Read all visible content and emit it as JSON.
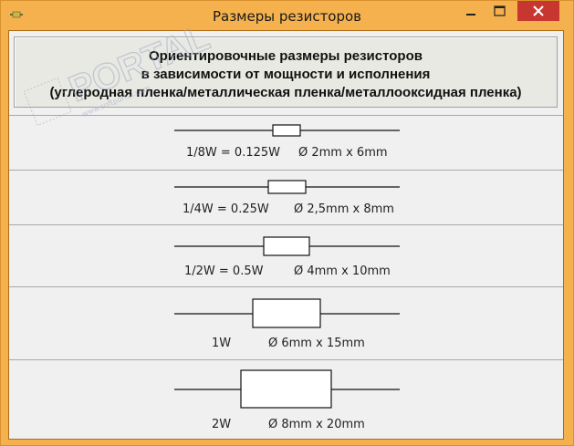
{
  "window": {
    "title": "Размеры резисторов",
    "accent": "#f5b14e",
    "close_color": "#c7372f"
  },
  "header": {
    "line1": "Ориентировочные размеры резисторов",
    "line2": "в зависимости от мощности и исполнения",
    "line3": "(углеродная пленка/металлическая пленка/металлооксидная пленка)"
  },
  "resistors": [
    {
      "power": "1/8W = 0.125W",
      "size": "Ø 2mm x 6mm"
    },
    {
      "power": "1/4W = 0.25W",
      "size": "Ø 2,5mm x 8mm"
    },
    {
      "power": "1/2W = 0.5W",
      "size": "Ø 4mm x 10mm"
    },
    {
      "power": "1W",
      "size": "Ø 6mm x 15mm"
    },
    {
      "power": "2W",
      "size": "Ø 8mm x 20mm"
    }
  ],
  "watermark": {
    "text": "PORTAL",
    "subtext": "www.softportal.com"
  }
}
